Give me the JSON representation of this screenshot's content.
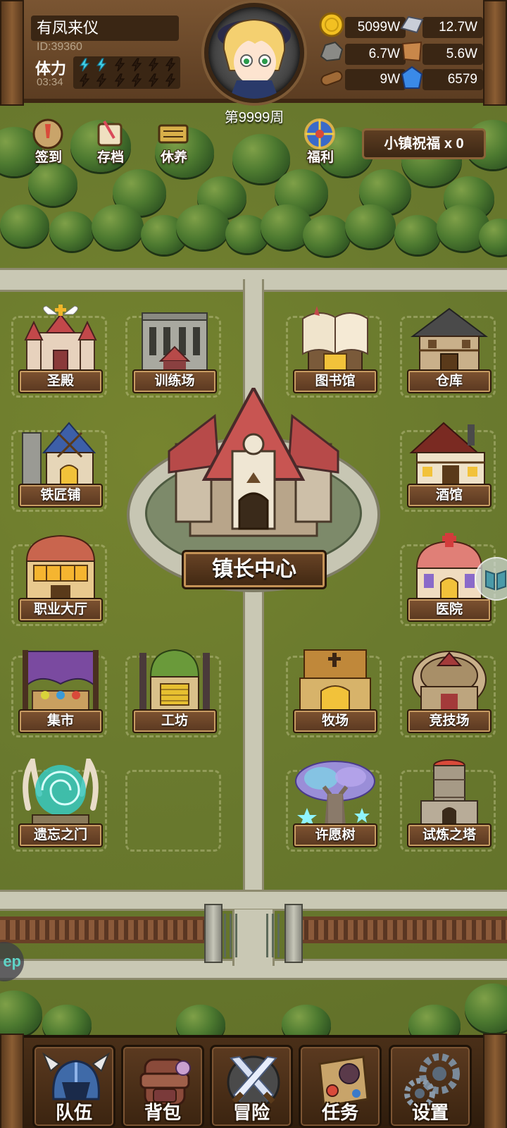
{
  "player": {
    "name": "有凤来仪",
    "id_text": "ID:39360",
    "stamina_label": "体力",
    "stamina_timer": "03:34",
    "stamina_filled": 2,
    "stamina_max": 6,
    "week_text": "第9999周"
  },
  "resources": [
    {
      "icon": "gold-coin-icon",
      "value": "5099W"
    },
    {
      "icon": "iron-ingot-icon",
      "value": "12.7W"
    },
    {
      "icon": "stone-ore-icon",
      "value": "6.7W"
    },
    {
      "icon": "leather-hide-icon",
      "value": "5.6W"
    },
    {
      "icon": "wood-log-icon",
      "value": "9W"
    },
    {
      "icon": "crystal-icon",
      "value": "6579"
    }
  ],
  "quick_menu": [
    {
      "icon": "checkin-icon",
      "label": "签到"
    },
    {
      "icon": "save-scroll-icon",
      "label": "存档"
    },
    {
      "icon": "rest-sign-icon",
      "label": "休养"
    },
    {
      "icon": "welfare-wheel-icon",
      "label": "福利"
    }
  ],
  "blessing": "小镇祝福 x 0",
  "buildings": {
    "sanctuary": "圣殿",
    "training": "训练场",
    "library": "图书馆",
    "warehouse": "仓库",
    "blacksmith": "铁匠铺",
    "tavern": "酒馆",
    "job_hall": "职业大厅",
    "hospital": "医院",
    "market": "集市",
    "workshop": "工坊",
    "ranch": "牧场",
    "arena": "竞技场",
    "forgotten_gate": "遗忘之门",
    "wish_tree": "许愿树",
    "trial_tower": "试炼之塔",
    "mayor_center": "镇长中心"
  },
  "side_button_text": "ep",
  "bottom_nav": [
    {
      "icon": "helmet-icon",
      "label": "队伍"
    },
    {
      "icon": "backpack-icon",
      "label": "背包"
    },
    {
      "icon": "crossed-swords-icon",
      "label": "冒险"
    },
    {
      "icon": "quest-scroll-icon",
      "label": "任务"
    },
    {
      "icon": "gears-icon",
      "label": "设置"
    }
  ],
  "colors": {
    "wood_dark": "#3a2614",
    "grass": "#6a7a2e",
    "road": "#c9c8b4",
    "label_text": "#ffffff"
  }
}
